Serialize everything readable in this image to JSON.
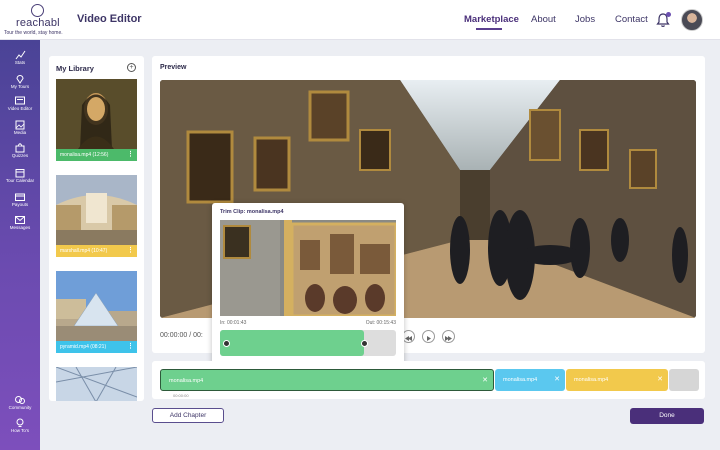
{
  "header": {
    "logo_name": "reachabl",
    "logo_tagline": "Tour the world, stay home.",
    "app_title": "Video Editor",
    "nav": [
      {
        "label": "Marketplace",
        "active": true
      },
      {
        "label": "About",
        "active": false
      },
      {
        "label": "Jobs",
        "active": false
      },
      {
        "label": "Contact",
        "active": false
      }
    ]
  },
  "sidebar": {
    "items": [
      {
        "label": "Stats",
        "icon": "chart-icon"
      },
      {
        "label": "My Tours",
        "icon": "map-pin-icon"
      },
      {
        "label": "Video Editor",
        "icon": "video-icon"
      },
      {
        "label": "Media",
        "icon": "image-icon"
      },
      {
        "label": "Quizzes",
        "icon": "puzzle-icon"
      },
      {
        "label": "Tour Calendar",
        "icon": "calendar-icon"
      },
      {
        "label": "Payouts",
        "icon": "card-icon"
      },
      {
        "label": "Messages",
        "icon": "mail-icon"
      }
    ],
    "bottom_items": [
      {
        "label": "Community",
        "icon": "chat-icon"
      },
      {
        "label": "How To's",
        "icon": "lightbulb-icon"
      }
    ]
  },
  "library": {
    "title": "My Library",
    "items": [
      {
        "label": "monalisa.mp4 (12:56)",
        "color": "#4cba6a"
      },
      {
        "label": "marshall.mp4 (10:47)",
        "color": "#f2c94c"
      },
      {
        "label": "pyramid.mp4 (08:21)",
        "color": "#3ec3ea"
      }
    ]
  },
  "preview": {
    "title": "Preview",
    "time": "00:00:00 / 00:"
  },
  "trim": {
    "title": "Trim Clip: monalisa.mp4",
    "in_label": "In: 00:01:43",
    "out_label": "Out: 00:15:43"
  },
  "timeline": {
    "segments": [
      {
        "label": "monalisa.mp4",
        "color": "#6ed08e"
      },
      {
        "label": "monalisa.mp4",
        "color": "#5bc8ef"
      },
      {
        "label": "monalisa.mp4",
        "color": "#f2c94c"
      }
    ],
    "start_time": "00:00:00"
  },
  "buttons": {
    "add_chapter": "Add Chapter",
    "done": "Done"
  }
}
